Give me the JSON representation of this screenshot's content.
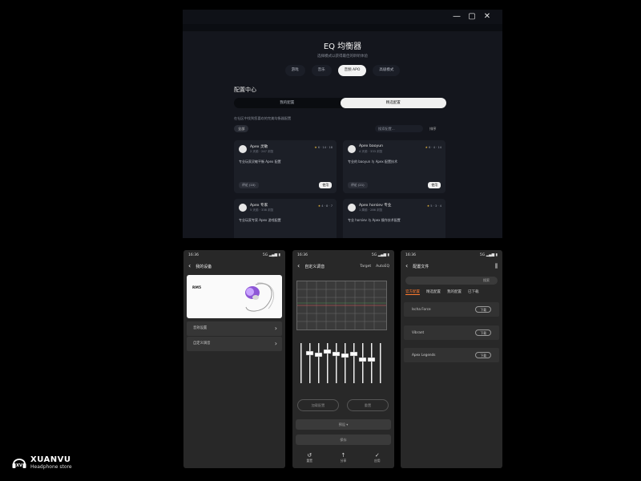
{
  "desktop": {
    "title": "EQ 均衡器",
    "subtitle": "选择模式以获得最佳的聆听体验",
    "tabs": [
      "游戏",
      "音乐",
      "音频 APO",
      "高级模式"
    ],
    "section_title": "配置中心",
    "segments": [
      "我的配置",
      "精选配置"
    ],
    "hint": "在社区中找到您喜欢的完美均衡器配置",
    "chip": "全部",
    "search_placeholder": "搜索配置...",
    "sort_label": "排序",
    "cards": [
      {
        "name": "Apex 灵敏",
        "meta": "2 天前 · 247 浏览",
        "stats": "6 · 14 · 18",
        "desc": "专业玩家灵敏平衡 Apex 配置",
        "comments": "评论 (10)",
        "use": "使用"
      },
      {
        "name": "Apex baoyun",
        "meta": "4 天前 · 333 浏览",
        "stats": "6 · 4 · 14",
        "desc": "专业的 baoyun 与 Apex 配置技术",
        "comments": "评论 (21)",
        "use": "使用"
      },
      {
        "name": "Apex 专家",
        "meta": "5 天前 · 338 浏览",
        "stats": "4 · 8 · 7",
        "desc": "专业玩家专家 Apex 游戏配置",
        "comments": "",
        "use": ""
      },
      {
        "name": "Apex horsiev 专业",
        "meta": "1 周前 · 286 浏览",
        "stats": "5 · 3 · 4",
        "desc": "专业 horsiev 与 Apex 操作技术配置",
        "comments": "",
        "use": ""
      }
    ]
  },
  "phone1": {
    "time": "16:36",
    "signal": "5G ▂▄▆ ▮",
    "title": "我的设备",
    "product_label": "RM5",
    "rows": [
      "音效设置",
      "自定义调音"
    ]
  },
  "phone2": {
    "time": "16:36",
    "signal": "5G ▂▄▆ ▮",
    "title": "自定义调音",
    "link1": "Target",
    "link2": "AutoEQ",
    "btn_left": "加载配置",
    "btn_right": "重置",
    "bar1": "预设 ▾",
    "bar2": "保存",
    "nav": [
      "重置",
      "分享",
      "应用"
    ]
  },
  "phone3": {
    "time": "16:36",
    "signal": "5G ▂▄▆ ▮",
    "title": "配置文件",
    "search_text": "搜索",
    "tabs": [
      "官方配置",
      "精选配置",
      "我的配置",
      "已下载"
    ],
    "rows": [
      {
        "name": "Ischa Force",
        "btn": "下载"
      },
      {
        "name": "Vibrant",
        "btn": "下载"
      },
      {
        "name": "Apex Legends",
        "btn": "下载"
      }
    ]
  },
  "brand": {
    "name": "XUANVU",
    "tagline": "Headphone store"
  },
  "colors": {
    "accent": "#ff7a2e",
    "star": "#e7b63a",
    "bg": "#000000",
    "window": "#14161d"
  }
}
